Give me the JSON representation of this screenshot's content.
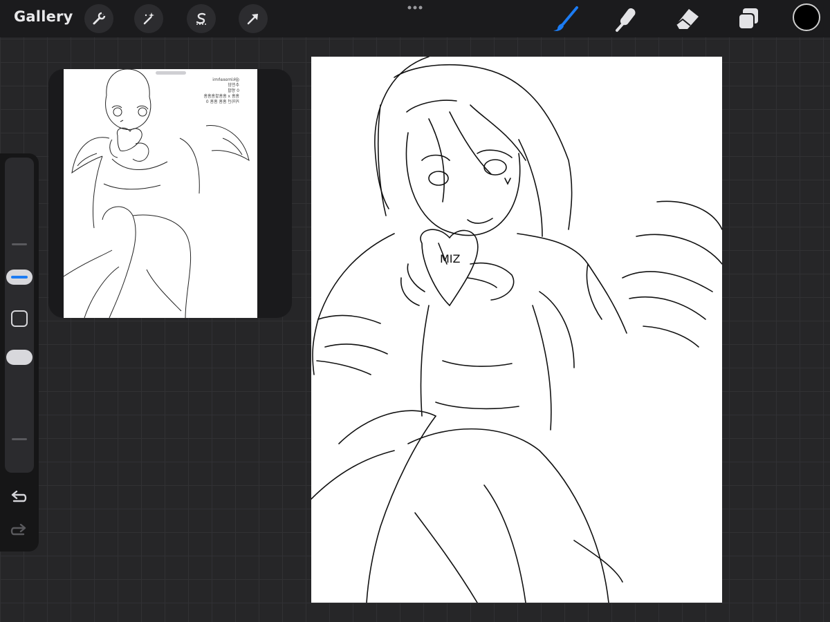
{
  "app": {
    "gallery_label": "Gallery"
  },
  "toolbar_left": [
    {
      "name": "actions",
      "icon": "wrench-icon"
    },
    {
      "name": "adjustments",
      "icon": "magic-wand-icon"
    },
    {
      "name": "selection",
      "icon": "selection-s-icon"
    },
    {
      "name": "transform",
      "icon": "arrow-cursor-icon"
    }
  ],
  "toolbar_right": [
    {
      "name": "brush",
      "icon": "brush-icon",
      "active": true
    },
    {
      "name": "smudge",
      "icon": "smudge-finger-icon"
    },
    {
      "name": "eraser",
      "icon": "eraser-icon"
    },
    {
      "name": "layers",
      "icon": "layers-icon"
    }
  ],
  "colors": {
    "accent": "#1c7cf3",
    "current_color": "#000000",
    "topbar": "#1b1b1d",
    "background": "#262628"
  },
  "sidebar": {
    "brush_size_icon": "brush-size-slider",
    "modify_icon": "square-icon",
    "opacity_icon": "opacity-slider",
    "undo_icon": "undo-icon",
    "redo_icon": "redo-icon"
  },
  "reference": {
    "note_text": "@kimseahmi\n추천함\n0 병렬\n흠흠 x 흠흠말흠흠흠\n커미션 흠흠 흠흠 0"
  },
  "canvas": {
    "sketch_text": "MIZ"
  }
}
